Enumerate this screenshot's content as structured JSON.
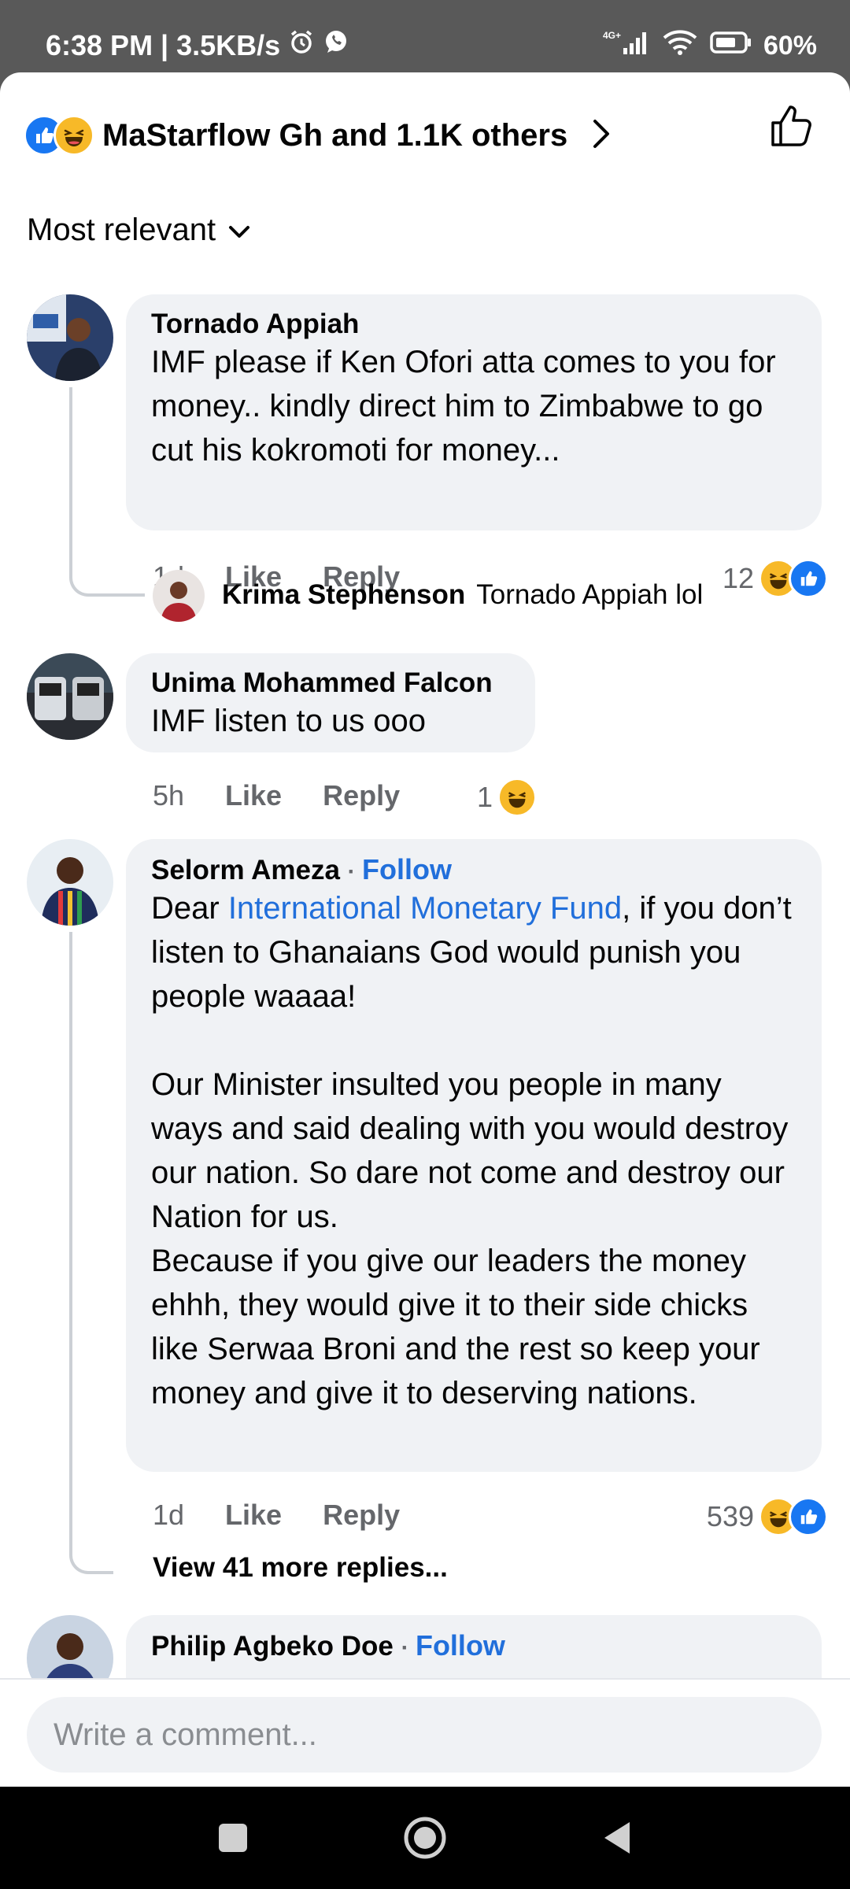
{
  "status_bar": {
    "time_speed": "6:38 PM | 3.5KB/s",
    "network": "4G+",
    "battery": "60%",
    "icons": [
      "alarm-icon",
      "whatsapp-icon",
      "signal-icon",
      "wifi-icon",
      "battery-icon"
    ]
  },
  "reactions_summary": {
    "label": "MaStarflow Gh and 1.1K others",
    "icons": [
      "like-icon",
      "haha-icon"
    ]
  },
  "sort": {
    "label": "Most relevant"
  },
  "comments": [
    {
      "author": "Tornado Appiah",
      "text": "IMF please if Ken Ofori atta comes to you for money.. kindly direct him to Zimbabwe to go cut his kokromoti for money...",
      "time": "1d",
      "like_label": "Like",
      "reply_label": "Reply",
      "reaction_count": "12",
      "reply": {
        "author": "Krima Stephenson",
        "text": "Tornado Appiah lol"
      }
    },
    {
      "author": "Unima Mohammed Falcon",
      "text": "IMF listen to us ooo",
      "time": "5h",
      "like_label": "Like",
      "reply_label": "Reply",
      "reaction_count": "1"
    },
    {
      "author": "Selorm Ameza",
      "follow_label": "Follow",
      "text_prefix": "Dear ",
      "text_link": "International Monetary Fund",
      "text_rest": ", if you don’t listen to Ghanaians God would punish you people waaaa!\n\nOur Minister insulted you people in many ways and said dealing with you would destroy our nation. So dare not come and destroy our Nation for us.\nBecause if you give our leaders the money ehhh, they would give it to their side chicks like Serwaa Broni and the rest so keep your money and give it to deserving nations.",
      "time": "1d",
      "like_label": "Like",
      "reply_label": "Reply",
      "reaction_count": "539",
      "more_replies": "View 41 more replies..."
    },
    {
      "author": "Philip Agbeko Doe",
      "follow_label": "Follow"
    }
  ],
  "composer": {
    "placeholder": "Write a comment..."
  },
  "colors": {
    "accent": "#1877f2",
    "link": "#216fdb",
    "bubble": "#f0f2f5",
    "haha": "#f7b928"
  }
}
